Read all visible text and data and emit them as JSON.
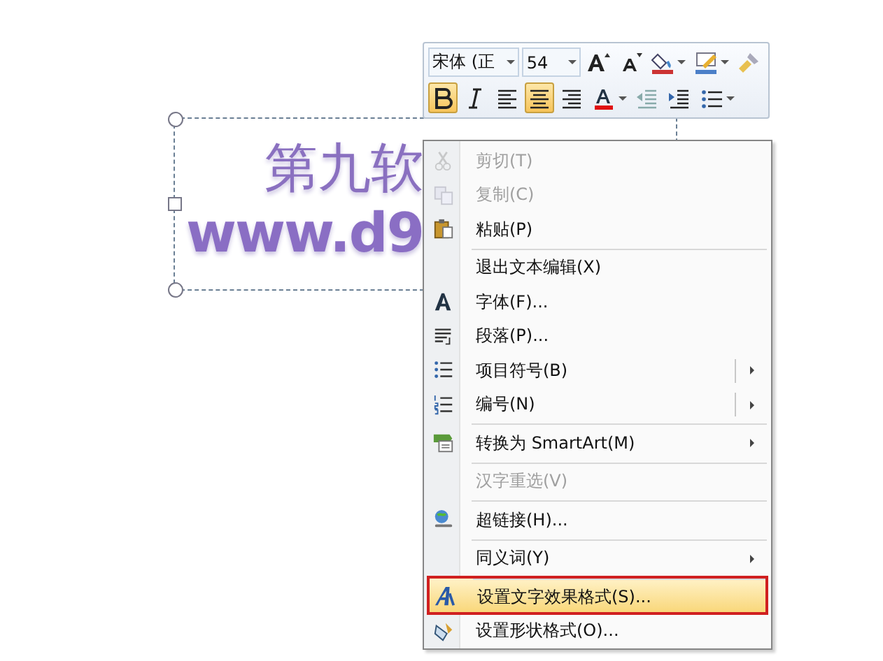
{
  "slide": {
    "textbox": {
      "lines": [
        "第九软",
        "www.d9"
      ]
    }
  },
  "mini_toolbar": {
    "font": "宋体 (正",
    "size": "54",
    "row1": [
      {
        "kind": "grow-font",
        "selected": false
      },
      {
        "kind": "shrink-font",
        "selected": false
      },
      {
        "kind": "fill",
        "selected": false
      },
      {
        "kind": "outline",
        "selected": false
      },
      {
        "kind": "painter",
        "selected": false
      }
    ],
    "row2": [
      {
        "kind": "bold",
        "selected": true
      },
      {
        "kind": "italic",
        "selected": false
      },
      {
        "kind": "align-left",
        "selected": false
      },
      {
        "kind": "align-center",
        "selected": true
      },
      {
        "kind": "align-right",
        "selected": false
      },
      {
        "kind": "font-color",
        "selected": false
      },
      {
        "kind": "outdent",
        "selected": false
      },
      {
        "kind": "indent",
        "selected": false
      },
      {
        "kind": "bullets",
        "selected": false
      }
    ]
  },
  "context_menu": {
    "items": [
      {
        "label": "剪切(T)",
        "disabled": true,
        "submenu": false,
        "split": false,
        "separator_before": false,
        "selected": false
      },
      {
        "label": "复制(C)",
        "disabled": true,
        "submenu": false,
        "split": false,
        "separator_before": false,
        "selected": false
      },
      {
        "label": "粘贴(P)",
        "disabled": false,
        "submenu": false,
        "split": false,
        "separator_before": false,
        "selected": false
      },
      {
        "label": "退出文本编辑(X)",
        "disabled": false,
        "submenu": false,
        "split": false,
        "separator_before": true,
        "selected": false
      },
      {
        "label": "字体(F)...",
        "disabled": false,
        "submenu": false,
        "split": false,
        "separator_before": false,
        "selected": false
      },
      {
        "label": "段落(P)...",
        "disabled": false,
        "submenu": false,
        "split": false,
        "separator_before": false,
        "selected": false
      },
      {
        "label": "项目符号(B)",
        "disabled": false,
        "submenu": true,
        "split": true,
        "separator_before": false,
        "selected": false
      },
      {
        "label": "编号(N)",
        "disabled": false,
        "submenu": true,
        "split": true,
        "separator_before": false,
        "selected": false
      },
      {
        "label": "转换为 SmartArt(M)",
        "disabled": false,
        "submenu": true,
        "split": false,
        "separator_before": true,
        "selected": false
      },
      {
        "label": "汉字重选(V)",
        "disabled": true,
        "submenu": false,
        "split": false,
        "separator_before": true,
        "selected": false
      },
      {
        "label": "超链接(H)...",
        "disabled": false,
        "submenu": false,
        "split": false,
        "separator_before": true,
        "selected": false
      },
      {
        "label": "同义词(Y)",
        "disabled": false,
        "submenu": true,
        "split": false,
        "separator_before": true,
        "selected": false
      },
      {
        "label": "设置文字效果格式(S)...",
        "disabled": false,
        "submenu": false,
        "split": false,
        "separator_before": true,
        "selected": true
      },
      {
        "label": "设置形状格式(O)...",
        "disabled": false,
        "submenu": false,
        "split": false,
        "separator_before": false,
        "selected": false
      }
    ]
  }
}
